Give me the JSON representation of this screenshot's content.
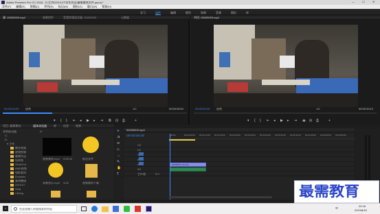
{
  "app": {
    "title": "Adobe Premiere Pro CC 2018 - D:\\工作\\2019.07\\学生作品\\最需素材文件.prproj *",
    "win_min": "—",
    "win_max": "☐",
    "win_close": "✕"
  },
  "menu": [
    "文件(F)",
    "编辑(E)",
    "剪辑(C)",
    "序列(S)",
    "标记(M)",
    "图形(G)",
    "窗口(W)",
    "帮助(H)"
  ],
  "workspaces": [
    {
      "label": "学习",
      "active": false
    },
    {
      "label": "组件",
      "active": true
    },
    {
      "label": "编辑",
      "active": false
    },
    {
      "label": "颜色",
      "active": false
    },
    {
      "label": "效果",
      "active": false
    },
    {
      "label": "音频",
      "active": false
    },
    {
      "label": "图形",
      "active": false
    },
    {
      "label": "库",
      "active": false
    }
  ],
  "source": {
    "tabs": [
      "源: 00009003.mp4",
      "效果控件",
      "音频剪辑混合器: 00009003",
      "元数据"
    ],
    "timecode_left": "00:00:00:00",
    "fit": "适合",
    "fraction": "1/2",
    "timecode_right": "00:00:05:01"
  },
  "program": {
    "tabs": [
      "节目: 00009003.mp4"
    ],
    "timecode_left": "00:00:00:00",
    "fit": "适合",
    "fraction": "1/2",
    "timecode_right": "00:00:33:12"
  },
  "project": {
    "tabs": [
      "项目: 最需素材",
      "媒体浏览器",
      "库",
      "信息",
      "效果"
    ],
    "path": "D:",
    "tree": [
      "本地驱动器",
      "C:",
      "D:",
      "▾ 工作",
      "教学视频",
      "视频剪辑",
      "最需作品",
      "短视频",
      "ShortCut",
      "AMD视频",
      "电影素材",
      "Dropbox",
      "素材整理",
      "2019.07",
      "Ozal",
      "Lifelog",
      "Kaist"
    ],
    "items": [
      {
        "name": "视频素材.mp4",
        "meta": "0:00:10",
        "type": "video"
      },
      {
        "name": "影音文件",
        "meta": "",
        "type": "app"
      },
      {
        "name": "背景音乐.mp3",
        "meta": "3:25",
        "type": "app"
      },
      {
        "name": "视频素材下载",
        "meta": "",
        "type": "folder"
      },
      {
        "name": "",
        "meta": "",
        "type": "folder"
      },
      {
        "name": "",
        "meta": "",
        "type": "folder"
      }
    ]
  },
  "timeline": {
    "tab": "00009003.mp4",
    "timecode": "00:00:00:00",
    "ruler": [
      "00:00",
      "00:00:05:00",
      "00:00:10:00",
      "00:00:15:00",
      "00:00:20:00",
      "00:00:25:00",
      "00:00:30:00",
      "00:00:35:00",
      "00:00:40:00",
      "00:00:45:00",
      "00:00:50:00",
      "00:00:55:00",
      "00:01:00:00"
    ],
    "tracks": [
      "V3",
      "V2",
      "V1",
      "A1",
      "A2",
      "A3",
      "主声道"
    ],
    "clip_label": "00009003.mp4 [V]",
    "master_value": "0.0"
  },
  "watermark": "最需教育",
  "taskbar": {
    "search_placeholder": "在这里输入你要搜索的内容",
    "time": "20:18",
    "date": "2019/8/20",
    "lang": "中"
  },
  "colors": {
    "accent": "#3d8cff",
    "clip": "#8b8ee8",
    "audio": "#2e8a57"
  }
}
